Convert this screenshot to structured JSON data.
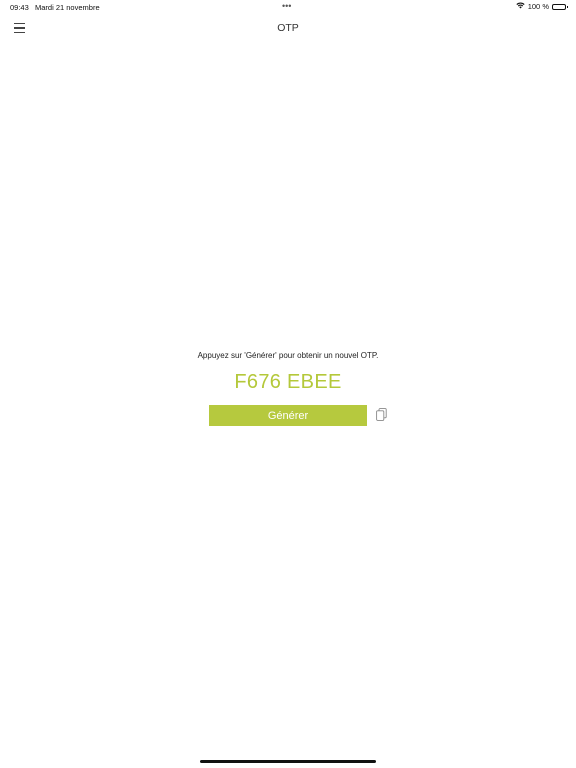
{
  "status_bar": {
    "time": "09:43",
    "date": "Mardi 21 novembre",
    "battery": "100 %",
    "icons": [
      "wifi-icon",
      "battery-icon"
    ]
  },
  "nav": {
    "title": "OTP",
    "menu_icon": "hamburger-menu-icon"
  },
  "main": {
    "instruction": "Appuyez sur 'Générer' pour obtenir un nouvel OTP.",
    "otp_code": "F676 EBEE",
    "generate_label": "Générer",
    "copy_icon": "copy-icon"
  },
  "colors": {
    "accent": "#b6c93e",
    "otp_text": "#b4c83a"
  }
}
